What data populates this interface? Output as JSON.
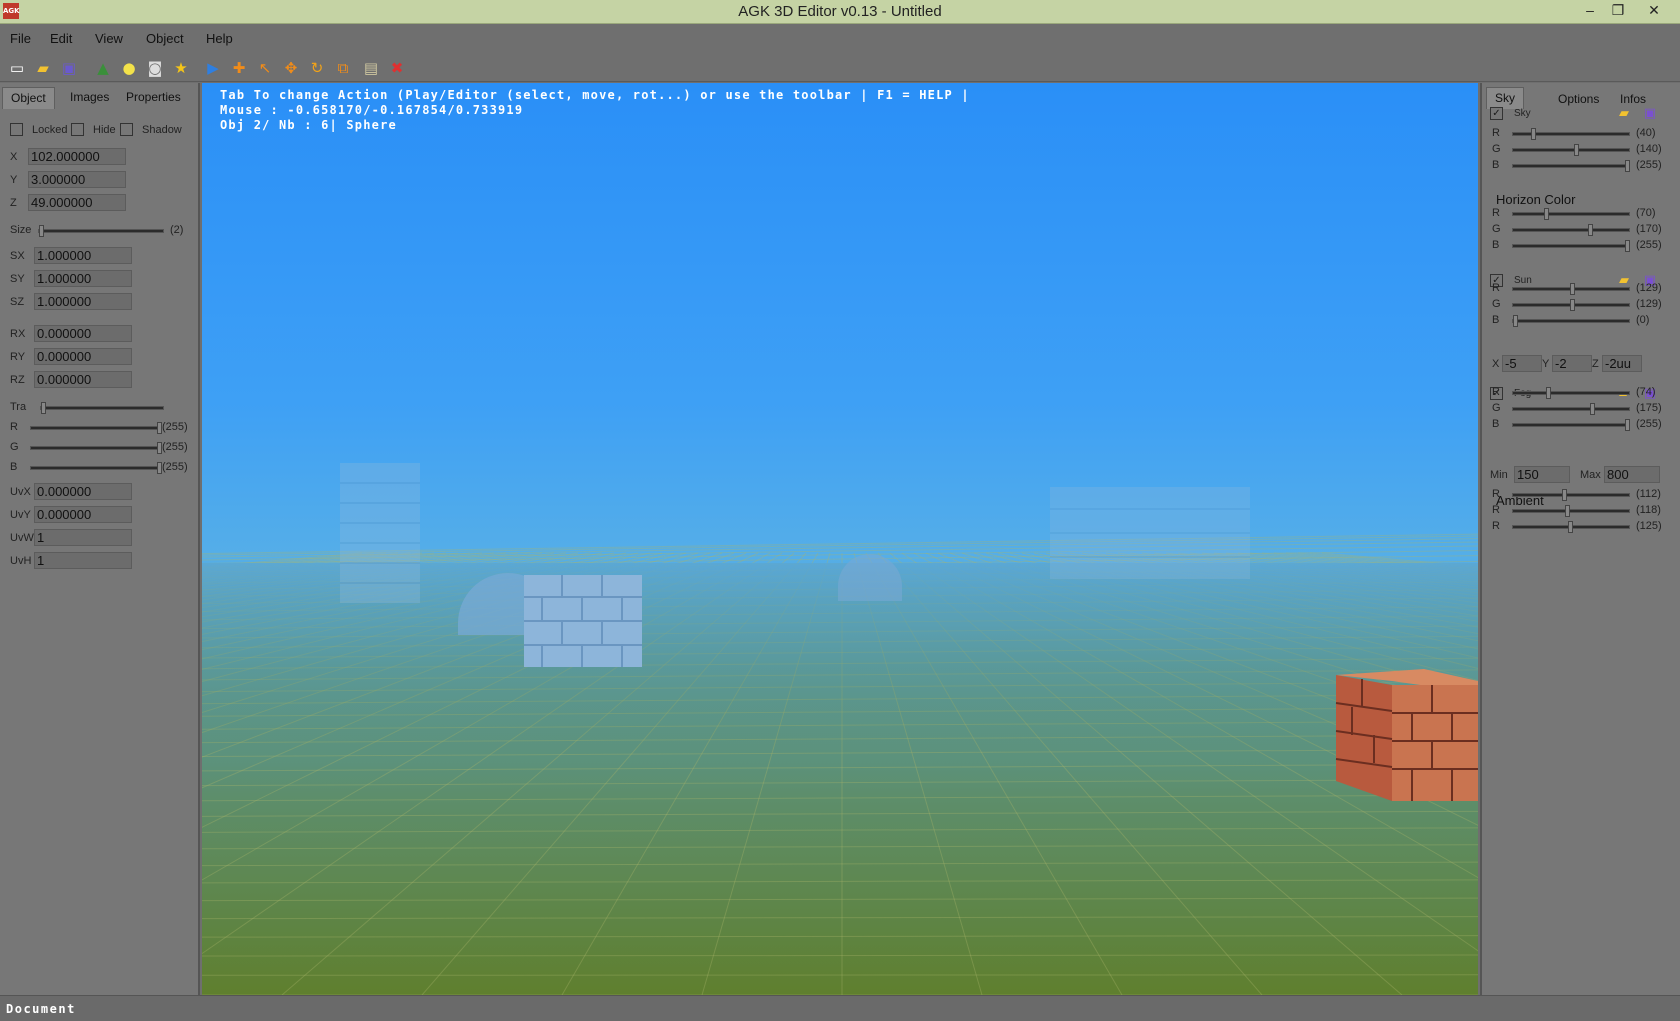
{
  "window": {
    "title": "AGK 3D Editor v0.13 - Untitled",
    "app_icon": "AGK"
  },
  "menu": [
    "File",
    "Edit",
    "View",
    "Object",
    "Help"
  ],
  "toolbar": [
    {
      "icon": "new-file-icon",
      "glyph": "▭",
      "color": "#ffffff"
    },
    {
      "icon": "open-folder-icon",
      "glyph": "▰",
      "color": "#f2c230"
    },
    {
      "icon": "save-icon",
      "glyph": "▣",
      "color": "#6a5acd"
    },
    {
      "icon": "terrain-icon",
      "glyph": "▲",
      "color": "#3a8f3a"
    },
    {
      "icon": "light-bulb-icon",
      "glyph": "●",
      "color": "#f3e24a"
    },
    {
      "icon": "camera-icon",
      "glyph": "◙",
      "color": "#dddddd"
    },
    {
      "icon": "star-icon",
      "glyph": "★",
      "color": "#f5c518"
    },
    {
      "icon": "play-icon",
      "glyph": "▶",
      "color": "#2f7fe0"
    },
    {
      "icon": "add-object-icon",
      "glyph": "✚",
      "color": "#f08c1a"
    },
    {
      "icon": "select-arrow-icon",
      "glyph": "↖",
      "color": "#f08c1a"
    },
    {
      "icon": "move-icon",
      "glyph": "✥",
      "color": "#f08c1a"
    },
    {
      "icon": "rotate-icon",
      "glyph": "↻",
      "color": "#f0a21a"
    },
    {
      "icon": "scale-icon",
      "glyph": "⧉",
      "color": "#f08c1a"
    },
    {
      "icon": "image-icon",
      "glyph": "▤",
      "color": "#cfc7a0"
    },
    {
      "icon": "delete-icon",
      "glyph": "✖",
      "color": "#e03030"
    }
  ],
  "left_panel": {
    "tabs": [
      "Object",
      "Images",
      "Properties"
    ],
    "checkboxes": [
      "Locked",
      "Hide",
      "Shadow"
    ],
    "position": [
      {
        "label": "X",
        "value": "102.000000"
      },
      {
        "label": "Y",
        "value": "3.000000"
      },
      {
        "label": "Z",
        "value": "49.000000"
      }
    ],
    "size": {
      "label": "Size",
      "value": "(2)"
    },
    "scale": [
      {
        "label": "SX",
        "value": "1.000000"
      },
      {
        "label": "SY",
        "value": "1.000000"
      },
      {
        "label": "SZ",
        "value": "1.000000"
      }
    ],
    "rotation": [
      {
        "label": "RX",
        "value": "0.000000"
      },
      {
        "label": "RY",
        "value": "0.000000"
      },
      {
        "label": "RZ",
        "value": "0.000000"
      }
    ],
    "transparency": {
      "label": "Tra"
    },
    "color": [
      {
        "label": "R",
        "value": "(255)"
      },
      {
        "label": "G",
        "value": "(255)"
      },
      {
        "label": "B",
        "value": "(255)"
      }
    ],
    "uv": [
      {
        "label": "UvX",
        "value": "0.000000"
      },
      {
        "label": "UvY",
        "value": "0.000000"
      },
      {
        "label": "UvW",
        "value": "1"
      },
      {
        "label": "UvH",
        "value": "1"
      }
    ]
  },
  "viewport": {
    "line1": "Tab To change Action (Play/Editor (select, move, rot...) or use the toolbar | F1 = HELP |",
    "line2": "Mouse : -0.658170/-0.167854/0.733919",
    "line3": "Obj 2/ Nb : 6| Sphere"
  },
  "right_panel": {
    "tabs": [
      "Sky",
      "Options",
      "Infos"
    ],
    "sky": {
      "label": "Sky",
      "rows": [
        {
          "label": "R",
          "value": "(40)"
        },
        {
          "label": "G",
          "value": "(140)"
        },
        {
          "label": "B",
          "value": "(255)"
        }
      ]
    },
    "horizon": {
      "label": "Horizon Color",
      "rows": [
        {
          "label": "R",
          "value": "(70)"
        },
        {
          "label": "G",
          "value": "(170)"
        },
        {
          "label": "B",
          "value": "(255)"
        }
      ]
    },
    "sun": {
      "label": "Sun",
      "rows": [
        {
          "label": "R",
          "value": "(129)"
        },
        {
          "label": "G",
          "value": "(129)"
        },
        {
          "label": "B",
          "value": "(0)"
        }
      ],
      "xyz": [
        {
          "label": "X",
          "value": "-5"
        },
        {
          "label": "Y",
          "value": "-2"
        },
        {
          "label": "Z",
          "value": "-2uu"
        }
      ]
    },
    "fog": {
      "label": "Fog",
      "rows": [
        {
          "label": "R",
          "value": "(74)"
        },
        {
          "label": "G",
          "value": "(175)"
        },
        {
          "label": "B",
          "value": "(255)"
        }
      ],
      "min_label": "Min",
      "min_value": "150",
      "max_label": "Max",
      "max_value": "800"
    },
    "ambient": {
      "label": "Ambient",
      "rows": [
        {
          "label": "R",
          "value": "(112)"
        },
        {
          "label": "R",
          "value": "(118)"
        },
        {
          "label": "R",
          "value": "(125)"
        }
      ]
    }
  },
  "status": "Document"
}
